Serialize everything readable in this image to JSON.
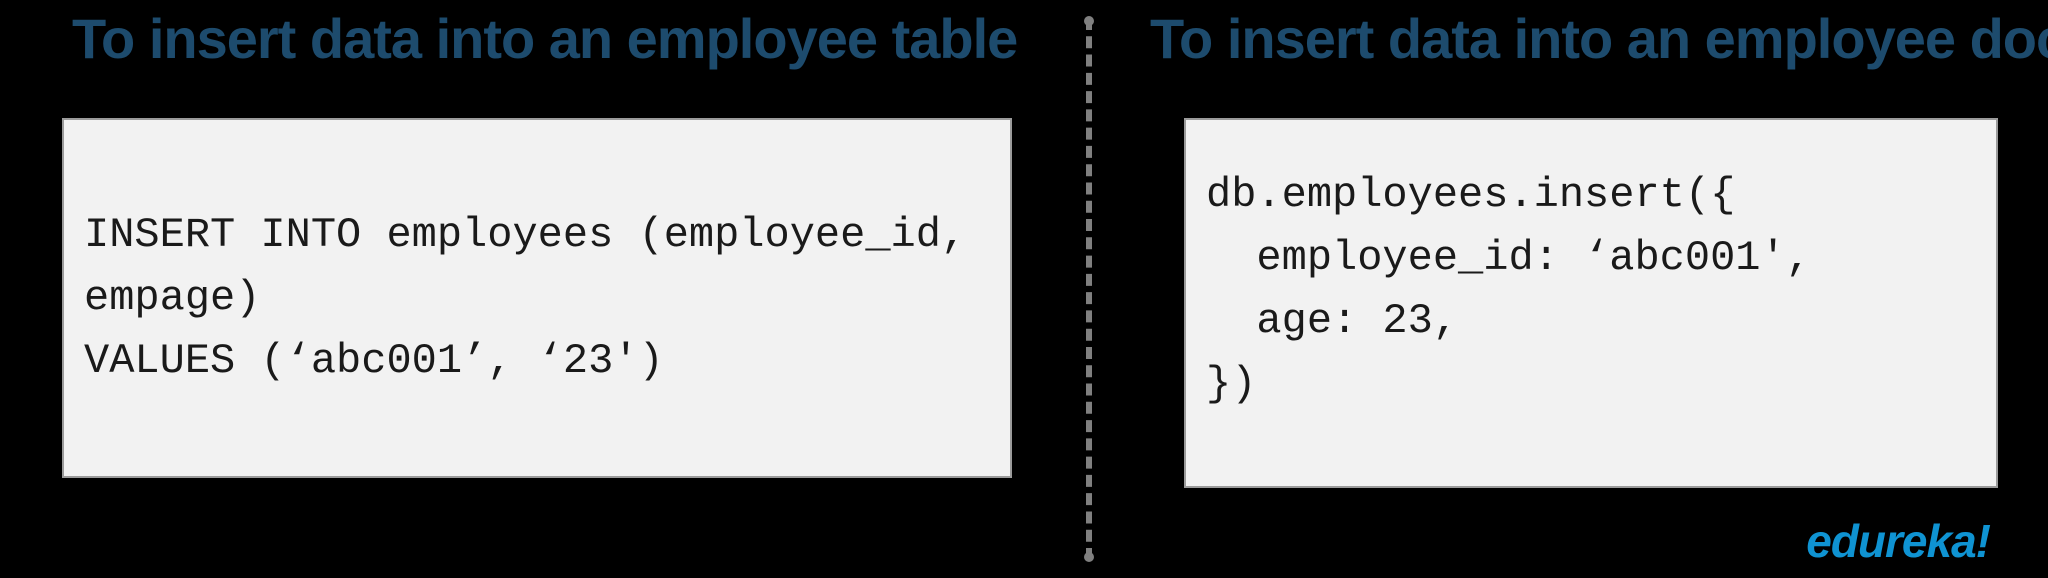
{
  "left": {
    "heading": "To insert data into an employee table",
    "code": "INSERT INTO employees (employee_id,\nempage)\nVALUES (‘abc001’, ‘23')"
  },
  "right": {
    "heading": "To insert data into an employee document",
    "code": "db.employees.insert({\n  employee_id: ‘abc001',\n  age: 23,\n})"
  },
  "brand": "edureka!"
}
